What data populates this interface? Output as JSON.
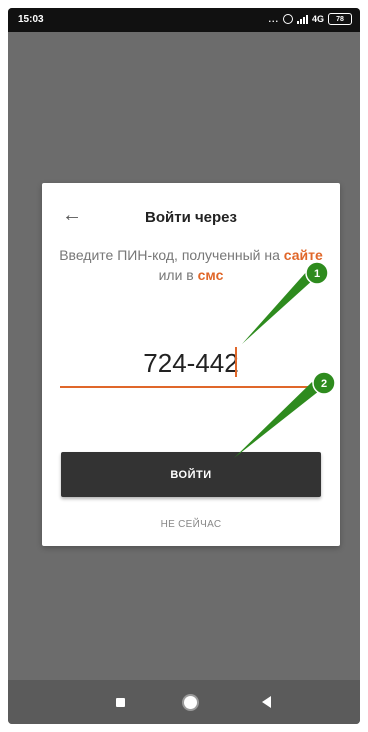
{
  "status_bar": {
    "time": "15:03",
    "dots": "...",
    "network": "4G",
    "battery": "78"
  },
  "dialog": {
    "title": "Войти через",
    "instruction_prefix": "Введите ПИН-код, полученный на",
    "link_site": "сайте",
    "instruction_middle": "или в",
    "link_sms": "смс",
    "pin_value": "724-442",
    "login_button": "ВОЙТИ",
    "not_now": "НЕ СЕЙЧАС"
  },
  "annotations": {
    "marker_1": "1",
    "marker_2": "2",
    "color": "#2e8b1e"
  },
  "colors": {
    "accent": "#e0672a",
    "button": "#333333",
    "overlay": "#6c6c6c"
  },
  "icons": {
    "back": "back-arrow-icon",
    "nav_recents": "square-icon",
    "nav_home": "circle-icon",
    "nav_back": "triangle-back-icon"
  }
}
